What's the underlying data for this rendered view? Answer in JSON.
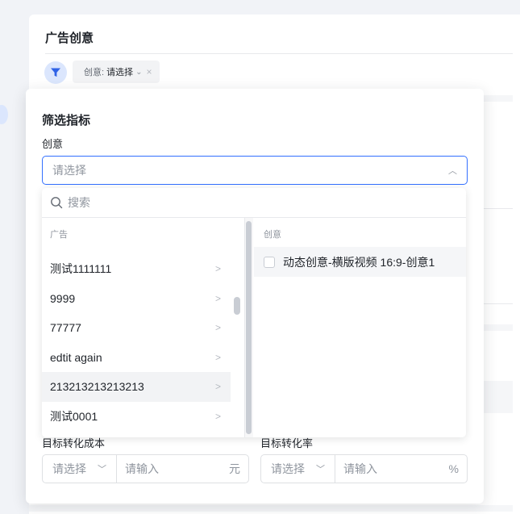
{
  "page": {
    "title": "广告创意"
  },
  "filter_chip": {
    "key": "创意:",
    "value": "请选择"
  },
  "panel": {
    "title": "筛选指标",
    "field_label": "创意",
    "select_placeholder": "请选择",
    "search_placeholder": "搜索",
    "left_column_header": "广告",
    "right_column_header": "创意",
    "ads": [
      {
        "label": "测试1111111"
      },
      {
        "label": "9999"
      },
      {
        "label": "77777"
      },
      {
        "label": "edtit again"
      },
      {
        "label": "213213213213213",
        "hovered": true
      },
      {
        "label": "测试0001"
      }
    ],
    "creatives": [
      {
        "label": "动态创意-横版视频 16:9-创意1",
        "checked": false
      }
    ],
    "target_cost": {
      "label": "目标转化成本",
      "select_placeholder": "请选择",
      "input_placeholder": "请输入",
      "unit": "元"
    },
    "target_rate": {
      "label": "目标转化率",
      "select_placeholder": "请选择",
      "input_placeholder": "请输入",
      "unit": "%"
    }
  },
  "colors": {
    "accent": "#3370ff",
    "accent_light": "#dbe6fd",
    "text": "#1f2329",
    "muted": "#8f959e"
  }
}
